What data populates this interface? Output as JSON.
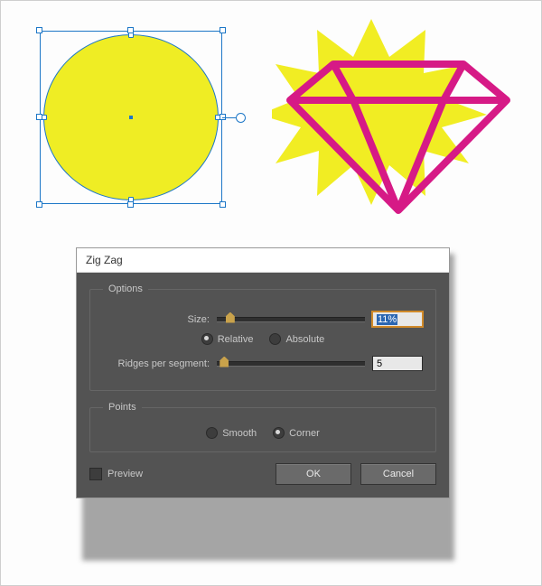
{
  "dialog": {
    "title": "Zig Zag",
    "options": {
      "legend": "Options",
      "size_label": "Size:",
      "size_value": "11%",
      "size_pos_pct": 6,
      "mode": {
        "relative_label": "Relative",
        "absolute_label": "Absolute",
        "selected": "relative"
      },
      "ridges_label": "Ridges per segment:",
      "ridges_value": "5",
      "ridges_pos_pct": 2
    },
    "points": {
      "legend": "Points",
      "smooth_label": "Smooth",
      "corner_label": "Corner",
      "selected": "corner"
    },
    "preview_label": "Preview",
    "preview_checked": false,
    "ok_label": "OK",
    "cancel_label": "Cancel"
  },
  "canvas": {
    "selected_shape": "circle",
    "fill": "#efed24",
    "diamond_stroke": "#d61a86",
    "starburst_fill": "#f1ed23"
  }
}
